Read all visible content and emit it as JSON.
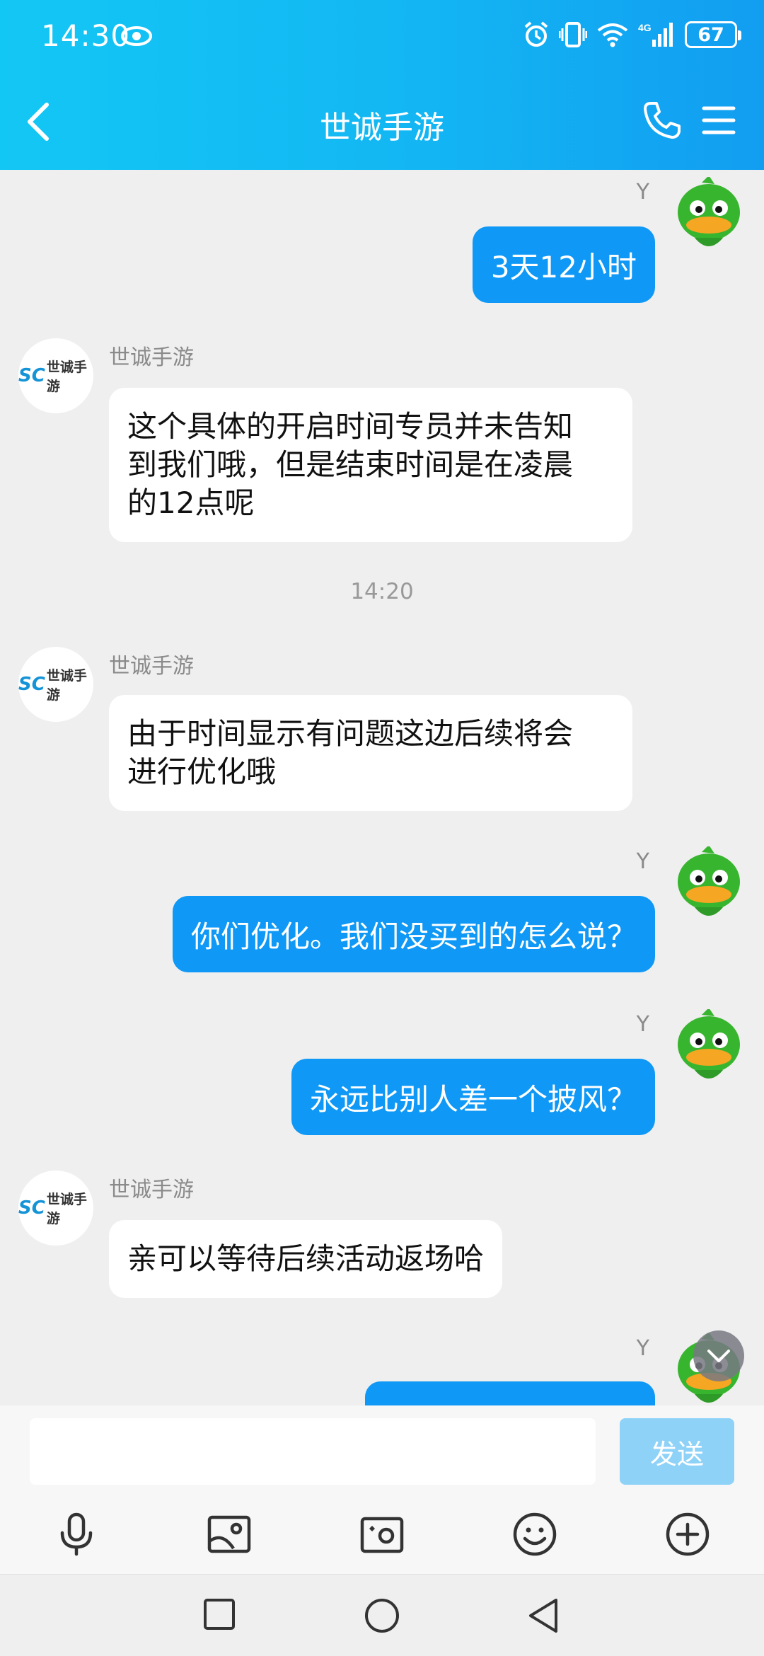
{
  "status_bar": {
    "time": "14:30",
    "battery": "67",
    "network": "4G"
  },
  "header": {
    "title": "世诚手游"
  },
  "messages": [
    {
      "side": "out",
      "sender": "Y",
      "text": "3天12小时"
    },
    {
      "side": "in",
      "sender": "世诚手游",
      "lines": [
        "这个具体的开启时间专员并未告知",
        "到我们哦，但是结束时间是在凌晨",
        "的12点呢"
      ]
    },
    {
      "type": "time",
      "text": "14:20"
    },
    {
      "side": "in",
      "sender": "世诚手游",
      "lines": [
        "由于时间显示有问题这边后续将会",
        "进行优化哦"
      ]
    },
    {
      "side": "out",
      "sender": "Y",
      "text": "你们优化。我们没买到的怎么说？"
    },
    {
      "side": "out",
      "sender": "Y",
      "text": "永远比别人差一个披风？"
    },
    {
      "side": "in",
      "sender": "世诚手游",
      "lines": [
        "亲可以等待后续活动返场哈"
      ]
    },
    {
      "side": "out",
      "sender": "Y",
      "text": ""
    }
  ],
  "avatar_logo": {
    "mark": "SC",
    "text": "世诚手游"
  },
  "input": {
    "placeholder": "",
    "send_label": "发送"
  },
  "toolbar": [
    "microphone-icon",
    "image-icon",
    "camera-icon",
    "emoji-icon",
    "plus-icon"
  ],
  "colors": {
    "header": "#13b6f3",
    "bubble_out": "#0f98f5",
    "send_disabled": "#8fd2f8"
  }
}
